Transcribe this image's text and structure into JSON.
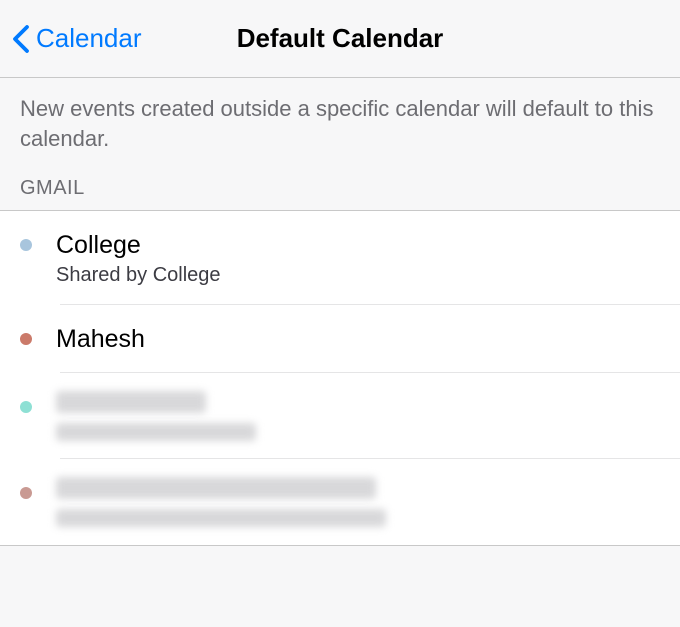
{
  "navbar": {
    "back_label": "Calendar",
    "title": "Default Calendar"
  },
  "description": "New events created outside a specific calendar will default to this calendar.",
  "section": {
    "header": "GMAIL"
  },
  "calendars": [
    {
      "color": "#a8c5dd",
      "name": "College",
      "subtitle": "Shared by College",
      "blurred": false
    },
    {
      "color": "#cb7a6a",
      "name": "Mahesh",
      "subtitle": "",
      "blurred": false
    },
    {
      "color": "#8ee0d4",
      "name": "",
      "subtitle": "",
      "blurred": true,
      "blur_title_width": 150,
      "blur_sub_width": 200
    },
    {
      "color": "#c99a93",
      "name": "",
      "subtitle": "",
      "blurred": true,
      "blur_title_width": 320,
      "blur_sub_width": 330
    }
  ]
}
